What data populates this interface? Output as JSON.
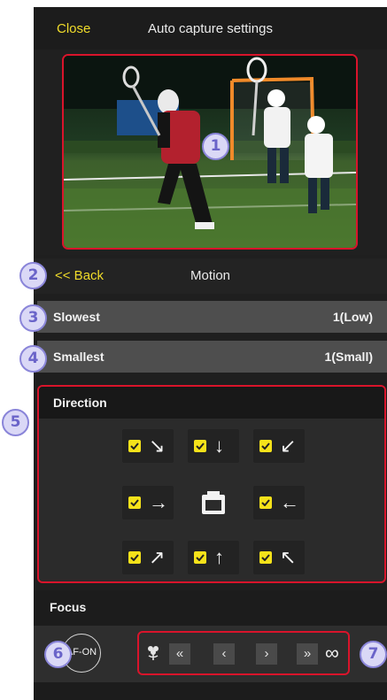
{
  "header": {
    "close_label": "Close",
    "title": "Auto capture settings"
  },
  "preview": {
    "description_icon": "lacrosse-players-photo"
  },
  "motion_nav": {
    "back_label": "<< Back",
    "title": "Motion"
  },
  "speed": {
    "label": "Slowest",
    "value": "1(Low)"
  },
  "size": {
    "label": "Smallest",
    "value": "1(Small)"
  },
  "direction": {
    "heading": "Direction",
    "cells": [
      {
        "arrow": "↘",
        "checked": true
      },
      {
        "arrow": "↓",
        "checked": true
      },
      {
        "arrow": "↙",
        "checked": true
      },
      {
        "arrow": "→",
        "checked": true
      },
      {
        "arrow": "←",
        "checked": true
      },
      {
        "arrow": "↗",
        "checked": true
      },
      {
        "arrow": "↑",
        "checked": true
      },
      {
        "arrow": "↖",
        "checked": true
      }
    ],
    "center_icon": "camera-icon"
  },
  "focus": {
    "heading": "Focus",
    "af_on_label": "AF-ON",
    "buttons": [
      "«",
      "‹",
      "›",
      "»"
    ],
    "near_icon": "macro-flower-icon",
    "far_label": "∞"
  },
  "callouts": [
    "1",
    "2",
    "3",
    "4",
    "5",
    "6",
    "7"
  ],
  "colors": {
    "accent": "#f0dc2a",
    "highlight_border": "#d9142b",
    "callout_fill": "#dad8f6",
    "callout_text": "#6a64c9"
  }
}
